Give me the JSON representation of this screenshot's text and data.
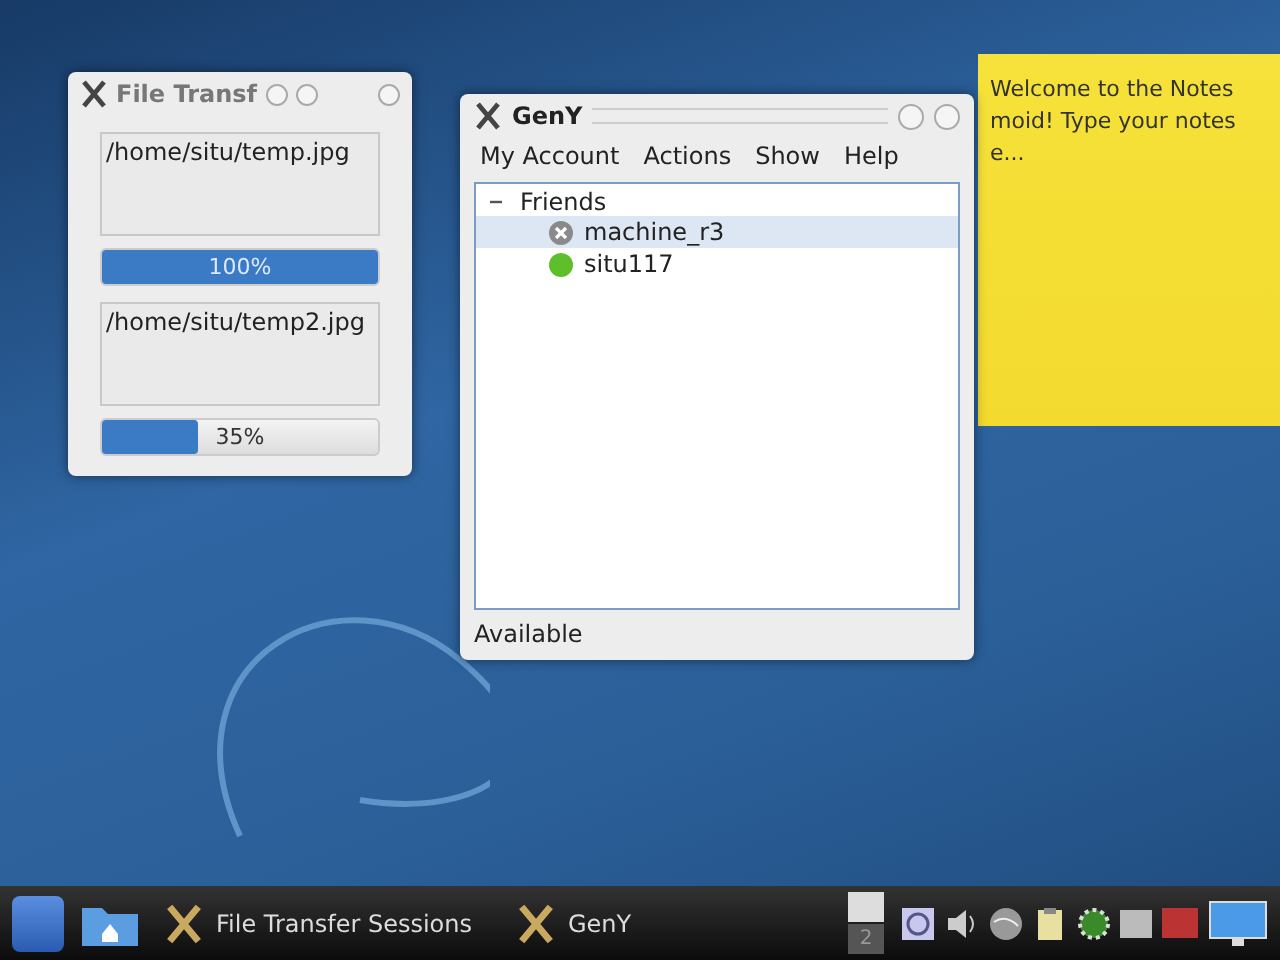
{
  "file_transfer_window": {
    "title": "File Transf",
    "transfers": [
      {
        "file": "/home/situ/temp.jpg",
        "level": 1.0,
        "reading": "100%"
      },
      {
        "file": "/home/situ/temp2.jpg",
        "level": 0.35,
        "reading": "35%"
      }
    ]
  },
  "geny_window": {
    "title": "GenY",
    "menu": [
      "My Account",
      "Actions",
      "Show",
      "Help"
    ],
    "tree": [
      {
        "label": "Friends",
        "expanded": true,
        "children": [
          {
            "label": "machine_r3",
            "kind": "offline",
            "selected": true
          },
          {
            "label": "situ117",
            "kind": "online",
            "selected": false
          }
        ]
      }
    ],
    "status_bar": "Available"
  },
  "note": {
    "lines": [
      "Welcome to the Notes",
      "moid! Type your notes",
      "e..."
    ]
  },
  "taskbar": {
    "tasks": [
      "File Transfer Sessions",
      "GenY"
    ],
    "pager": [
      {
        "selected": true
      },
      {
        "label": "2",
        "selected": false
      }
    ]
  }
}
